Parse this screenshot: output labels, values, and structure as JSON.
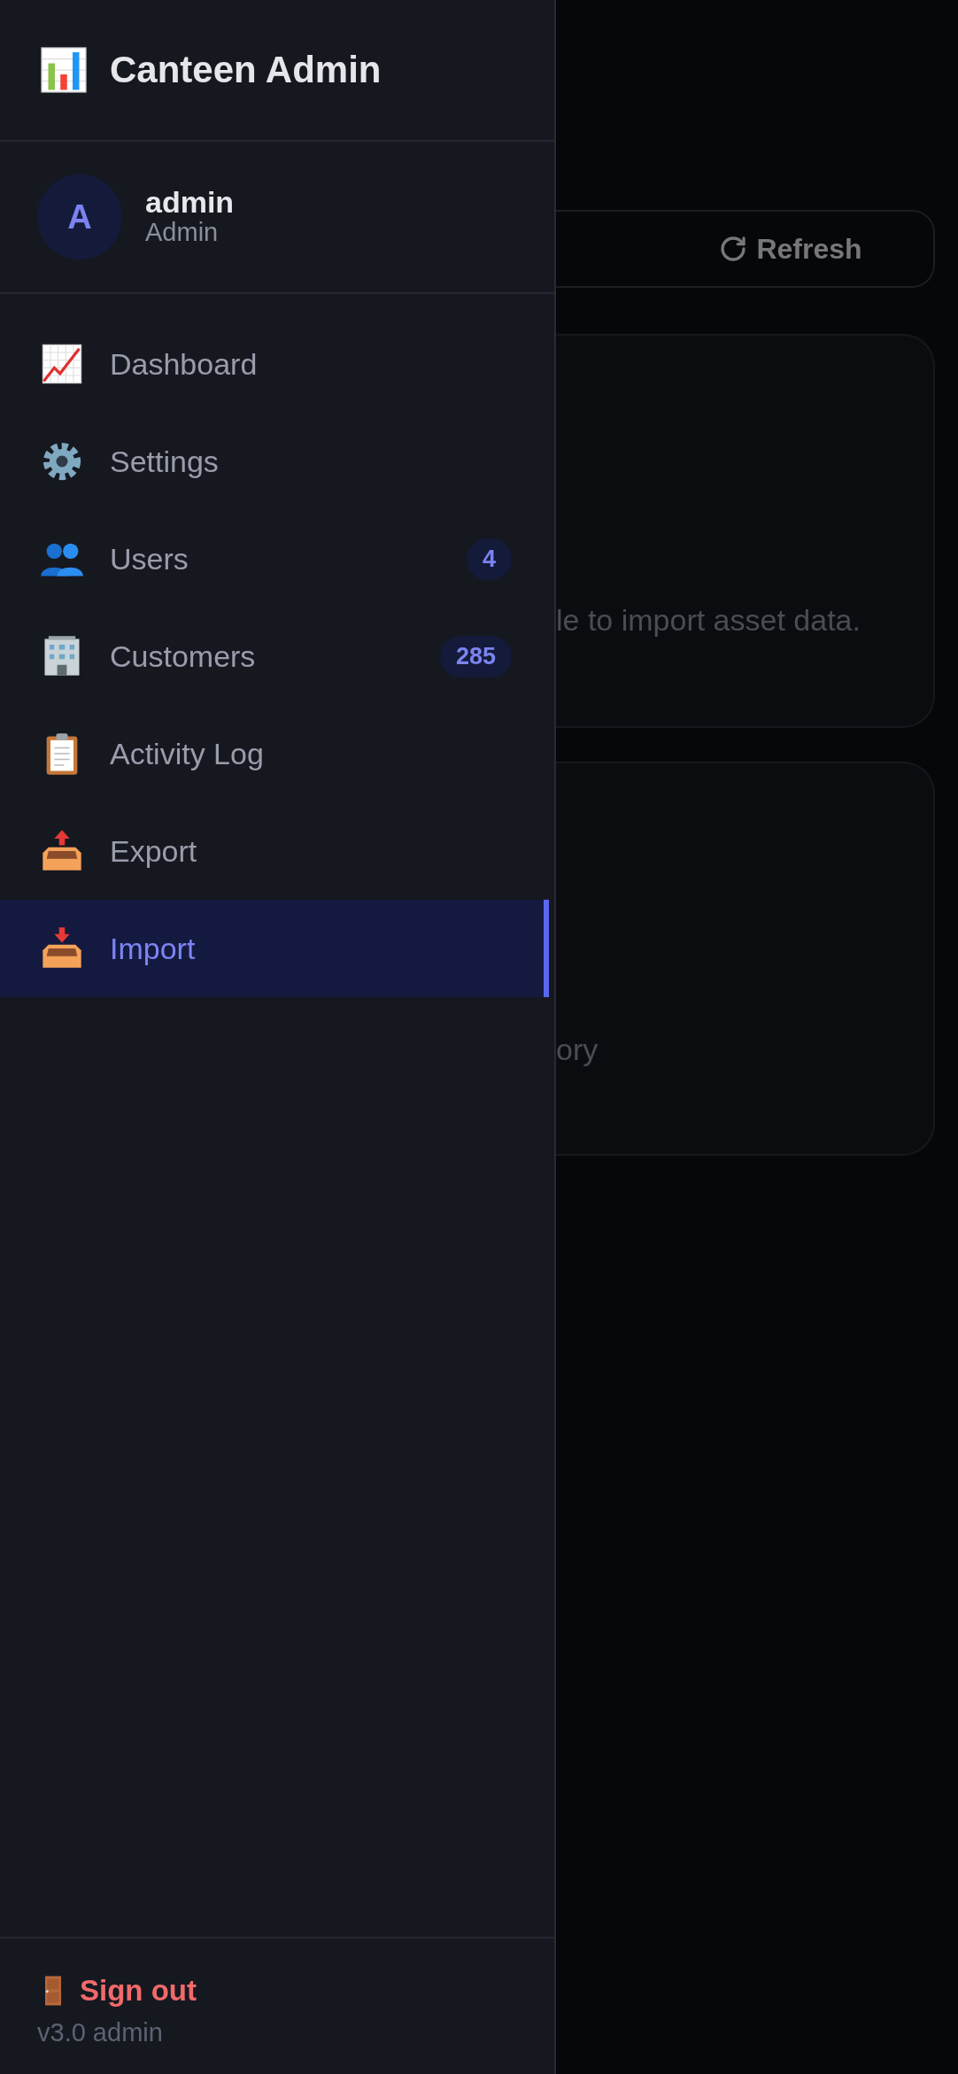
{
  "sidebar": {
    "title": "Canteen Admin",
    "user": {
      "avatar_letter": "A",
      "name": "admin",
      "role": "Admin"
    },
    "nav_items": [
      {
        "label": "Dashboard",
        "selected": false
      },
      {
        "label": "Settings",
        "selected": false
      },
      {
        "label": "Users",
        "badge": "4",
        "selected": false
      },
      {
        "label": "Customers",
        "badge": "285",
        "selected": false
      },
      {
        "label": "Activity Log",
        "selected": false
      },
      {
        "label": "Export",
        "selected": false
      },
      {
        "label": "Import",
        "selected": true
      }
    ],
    "sign_out": "Sign out",
    "version": "v3.0 admin"
  },
  "main": {
    "refresh_button": "Refresh",
    "cards": [
      {
        "text": "le to import asset data."
      },
      {
        "text": "ory"
      }
    ]
  }
}
